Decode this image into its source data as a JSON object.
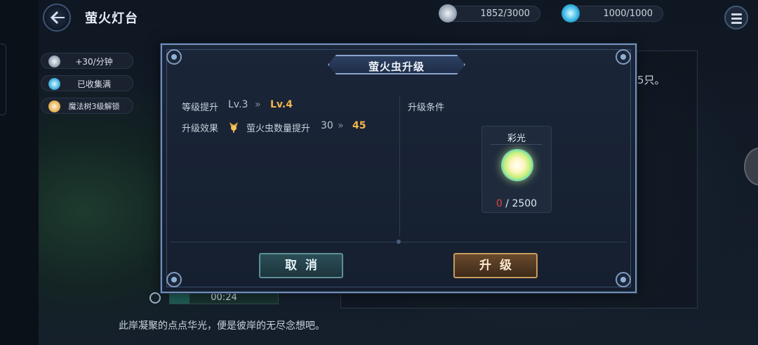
{
  "header": {
    "title": "萤火灯台",
    "resources": [
      {
        "icon": "gray-orb-icon",
        "value": "1852/3000"
      },
      {
        "icon": "blue-orb-icon",
        "value": "1000/1000"
      }
    ]
  },
  "status_chips": [
    {
      "icon": "gray-orb-icon",
      "label": "+30/分钟"
    },
    {
      "icon": "blue-orb-icon",
      "label": "已收集满"
    },
    {
      "icon": "gold-orb-icon",
      "label": "魔法树3级解锁"
    }
  ],
  "background": {
    "panel_text": "5只。",
    "timer": {
      "label": "00:24",
      "progress": 0.18
    },
    "bottom_text": "此岸凝聚的点点华光，便是彼岸的无尽念想吧。"
  },
  "modal": {
    "title": "萤火虫升级",
    "level_label": "等级提升",
    "level_from": "Lv.3",
    "level_to": "Lv.4",
    "effect_label": "升级效果",
    "effect_icon": "firefly-icon",
    "effect_name": "萤火虫数量提升",
    "effect_from": "30",
    "effect_to": "45",
    "requirements_label": "升级条件",
    "requirement": {
      "name": "彩光",
      "icon": "rainbow-light-orb-icon",
      "have": "0",
      "need": "/ 2500"
    },
    "cancel_label": "取消",
    "upgrade_label": "升级"
  },
  "colors": {
    "accent_gold": "#f3b44a",
    "alert_red": "#e0453a",
    "frame_blue": "#6f8eb8"
  }
}
